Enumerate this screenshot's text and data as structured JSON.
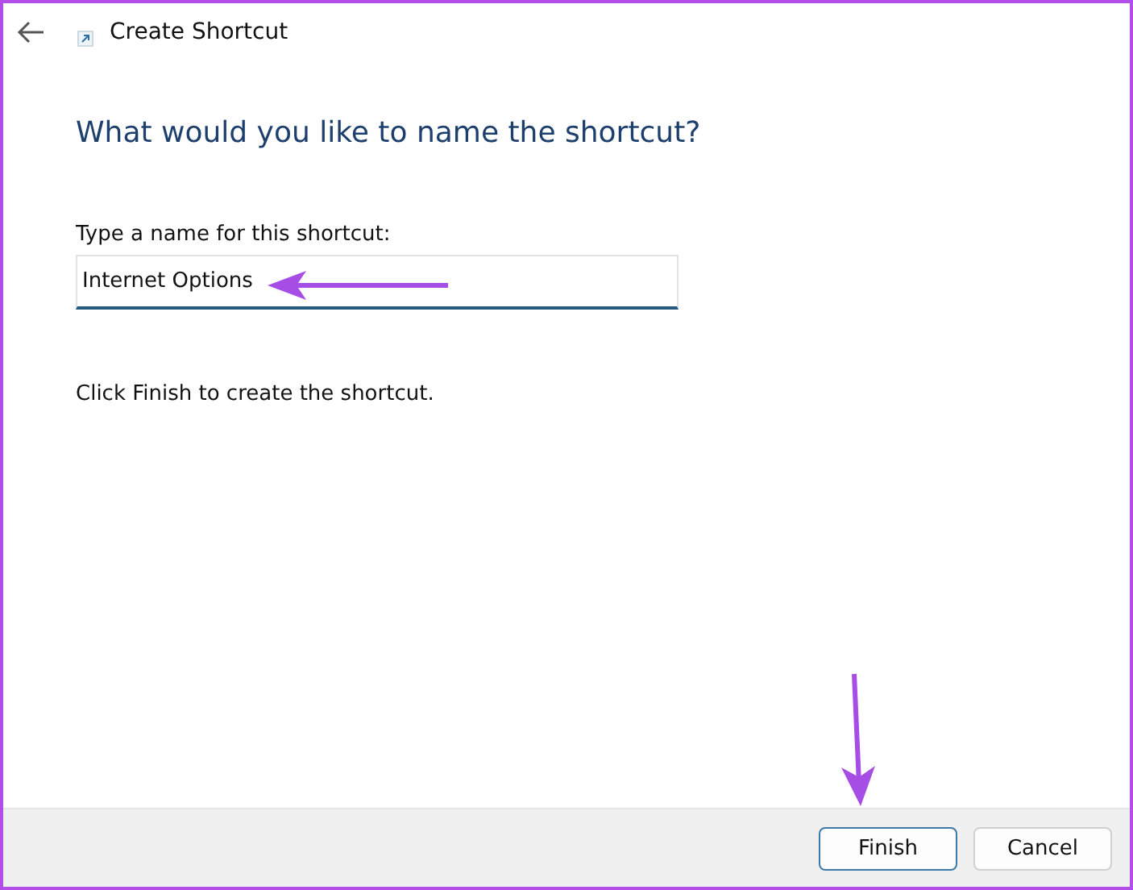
{
  "window": {
    "title": "Create Shortcut"
  },
  "heading": "What would you like to name the shortcut?",
  "name_field": {
    "label": "Type a name for this shortcut:",
    "value": "Internet Options"
  },
  "instruction": "Click Finish to create the shortcut.",
  "buttons": [
    {
      "label": "Finish",
      "default": true
    },
    {
      "label": "Cancel",
      "default": false
    }
  ]
}
